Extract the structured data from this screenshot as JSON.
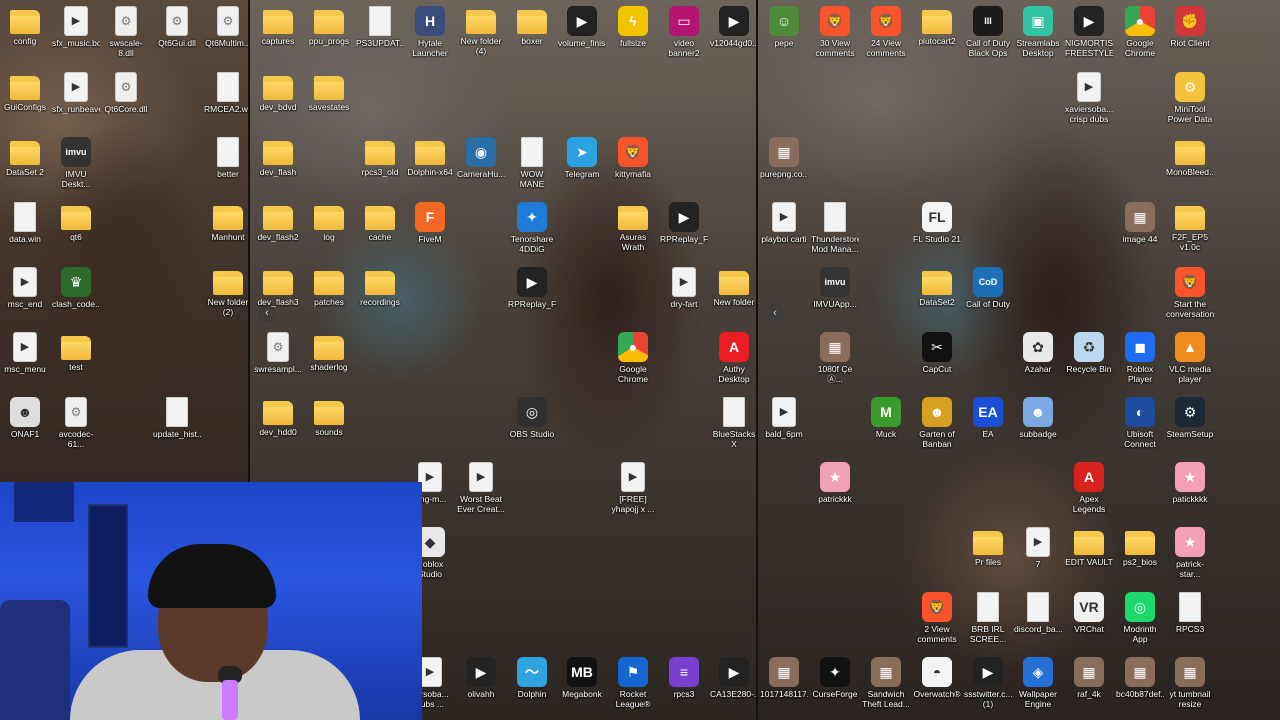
{
  "colors": {
    "folder": "#f0b93a",
    "brave": "#fb542b",
    "chrome": "#4285f4",
    "steam": "#1b2838",
    "roblox": "#1e6cf0",
    "webcam_bg": "#2a55e0"
  },
  "pane1": {
    "icons": [
      {
        "label": "config",
        "type": "folder"
      },
      {
        "label": "sfx_music.box",
        "type": "video"
      },
      {
        "label": "swscale-8.dll",
        "type": "gear"
      },
      {
        "label": "Qt6Gui.dll",
        "type": "gear"
      },
      {
        "label": "Qt6Multim...",
        "type": "gear"
      },
      {
        "label": "GuiConfigs",
        "type": "folder"
      },
      {
        "label": "sfx_runbeaver",
        "type": "video"
      },
      {
        "label": "Qt6Core.dll",
        "type": "gear"
      },
      {
        "label": "RMCEA2.w...",
        "type": "file"
      },
      {
        "label": "DataSet 2",
        "type": "folder"
      },
      {
        "label": "IMVU Deskt...",
        "type": "app",
        "icon": "imvu-icon"
      },
      {
        "label": "better",
        "type": "file"
      },
      {
        "label": "data.win",
        "type": "file"
      },
      {
        "label": "qt6",
        "type": "folder"
      },
      {
        "label": "Manhunt",
        "type": "folder"
      },
      {
        "label": "msc_end",
        "type": "video"
      },
      {
        "label": "clash_code...",
        "type": "app",
        "icon": "clash-icon"
      },
      {
        "label": "New folder (2)",
        "type": "folder"
      },
      {
        "label": "msc_menu",
        "type": "video"
      },
      {
        "label": "test",
        "type": "folder"
      },
      {
        "label": "ONAF1",
        "type": "app",
        "icon": "onaf-icon"
      },
      {
        "label": "avcodec-61...",
        "type": "gear"
      },
      {
        "label": "update_hist...",
        "type": "file"
      }
    ]
  },
  "pane2": {
    "icons": [
      {
        "label": "captures",
        "type": "folder"
      },
      {
        "label": "ppu_progs",
        "type": "folder"
      },
      {
        "label": "PS3UPDAT...",
        "type": "file"
      },
      {
        "label": "Hytale Launcher",
        "type": "app",
        "icon": "hytale-icon"
      },
      {
        "label": "New folder (4)",
        "type": "folder"
      },
      {
        "label": "boxer",
        "type": "folder"
      },
      {
        "label": "volume_finished",
        "type": "app",
        "icon": "video-thumb-icon"
      },
      {
        "label": "fullsize",
        "type": "app",
        "icon": "pikachu-icon"
      },
      {
        "label": "video banner2",
        "type": "app",
        "icon": "banner-icon"
      },
      {
        "label": "v12044gd0...",
        "type": "app",
        "icon": "video-thumb-icon"
      },
      {
        "label": "dev_bdvd",
        "type": "folder"
      },
      {
        "label": "savestates",
        "type": "folder"
      },
      {
        "label": "dev_flash",
        "type": "folder"
      },
      {
        "label": "rpcs3_old",
        "type": "folder"
      },
      {
        "label": "Dolphin-x64",
        "type": "folder"
      },
      {
        "label": "CameraHu...",
        "type": "app",
        "icon": "camera-icon"
      },
      {
        "label": "WOW MANE",
        "type": "file"
      },
      {
        "label": "Telegram",
        "type": "app",
        "icon": "telegram-icon"
      },
      {
        "label": "kittymafia",
        "type": "app",
        "icon": "brave-icon"
      },
      {
        "label": "dev_flash2",
        "type": "folder"
      },
      {
        "label": "log",
        "type": "folder"
      },
      {
        "label": "cache",
        "type": "folder"
      },
      {
        "label": "FiveM",
        "type": "app",
        "icon": "fivem-icon"
      },
      {
        "label": "Tenorshare 4DDiG",
        "type": "app",
        "icon": "tenorshare-icon"
      },
      {
        "label": "Asuras Wrath (USA) (En,Ja...",
        "type": "folder"
      },
      {
        "label": "RPReplay_F...",
        "type": "app",
        "icon": "video-thumb-icon"
      },
      {
        "label": "dev_flash3",
        "type": "folder"
      },
      {
        "label": "patches",
        "type": "folder"
      },
      {
        "label": "recordings",
        "type": "folder"
      },
      {
        "label": "RPReplay_F...",
        "type": "app",
        "icon": "video-thumb-icon"
      },
      {
        "label": "dry-fart",
        "type": "video"
      },
      {
        "label": "New folder",
        "type": "folder"
      },
      {
        "label": "swresampl...",
        "type": "gear"
      },
      {
        "label": "shaderlog",
        "type": "folder"
      },
      {
        "label": "Google Chrome",
        "type": "app",
        "icon": "chrome-icon"
      },
      {
        "label": "Authy Desktop",
        "type": "app",
        "icon": "authy-icon"
      },
      {
        "label": "dev_hdd0",
        "type": "folder"
      },
      {
        "label": "sounds",
        "type": "folder"
      },
      {
        "label": "OBS Studio",
        "type": "app",
        "icon": "obs-icon"
      },
      {
        "label": "BlueStacks X",
        "type": "file"
      },
      {
        "label": "king-m...",
        "type": "video"
      },
      {
        "label": "Worst Beat Ever Creat...",
        "type": "video"
      },
      {
        "label": "[FREE] yhapojj x ...",
        "type": "video"
      },
      {
        "label": "Roblox Studio",
        "type": "app",
        "icon": "roblox-studio-icon"
      },
      {
        "label": "versoba... dubs ...",
        "type": "video"
      },
      {
        "label": "olivahh",
        "type": "app",
        "icon": "video-thumb-icon"
      },
      {
        "label": "Dolphin",
        "type": "app",
        "icon": "dolphin-icon"
      },
      {
        "label": "Megabonk",
        "type": "app",
        "icon": "megabonk-icon"
      },
      {
        "label": "Rocket League®",
        "type": "app",
        "icon": "rocket-league-icon"
      },
      {
        "label": "rpcs3",
        "type": "app",
        "icon": "rpcs3-icon"
      },
      {
        "label": "CA13E280-...",
        "type": "app",
        "icon": "video-thumb-icon"
      }
    ]
  },
  "pane3": {
    "icons": [
      {
        "label": "pepe",
        "type": "app",
        "icon": "pepe-icon"
      },
      {
        "label": "30 View comments",
        "type": "app",
        "icon": "brave-icon"
      },
      {
        "label": "24 View comments",
        "type": "app",
        "icon": "brave-icon"
      },
      {
        "label": "plutocart2",
        "type": "folder"
      },
      {
        "label": "Call of Duty Black Ops III",
        "type": "app",
        "icon": "cod-icon"
      },
      {
        "label": "Streamlabs Desktop",
        "type": "app",
        "icon": "streamlabs-icon"
      },
      {
        "label": "NIGMORTIS FREESTYLE...",
        "type": "app",
        "icon": "video-thumb-icon"
      },
      {
        "label": "Google Chrome",
        "type": "app",
        "icon": "chrome-icon"
      },
      {
        "label": "Riot Client",
        "type": "app",
        "icon": "riot-icon"
      },
      {
        "label": "xaviersoba... crisp dubs ...",
        "type": "video"
      },
      {
        "label": "MiniTool Power Data ...",
        "type": "app",
        "icon": "minitool-icon"
      },
      {
        "label": "purepng.co...",
        "type": "app",
        "icon": "image-icon"
      },
      {
        "label": "MonoBleed...",
        "type": "folder"
      },
      {
        "label": "playboi carti",
        "type": "video"
      },
      {
        "label": "Thunderstore Mod Mana...",
        "type": "file"
      },
      {
        "label": "FL Studio 21",
        "type": "app",
        "icon": "fl-studio-icon"
      },
      {
        "label": "image 44",
        "type": "app",
        "icon": "image-icon"
      },
      {
        "label": "F2F_EP5 v1.0c",
        "type": "folder"
      },
      {
        "label": "IMVUApp...",
        "type": "app",
        "icon": "imvu-icon"
      },
      {
        "label": "DataSet2",
        "type": "folder"
      },
      {
        "label": "Call of Duty",
        "type": "app",
        "icon": "cod2-icon"
      },
      {
        "label": "Start the conversation",
        "type": "app",
        "icon": "brave-icon"
      },
      {
        "label": "1080f Çe Ⓐ... Facebook P...",
        "type": "app",
        "icon": "image-icon"
      },
      {
        "label": "CapCut",
        "type": "app",
        "icon": "capcut-icon"
      },
      {
        "label": "Azahar",
        "type": "app",
        "icon": "azahar-icon"
      },
      {
        "label": "Recycle Bin",
        "type": "app",
        "icon": "recycle-bin-icon"
      },
      {
        "label": "Roblox Player",
        "type": "app",
        "icon": "roblox-icon"
      },
      {
        "label": "VLC media player",
        "type": "app",
        "icon": "vlc-icon"
      },
      {
        "label": "bald_6pm",
        "type": "video"
      },
      {
        "label": "Muck",
        "type": "app",
        "icon": "muck-icon"
      },
      {
        "label": "Garten of Banban",
        "type": "app",
        "icon": "banban-icon"
      },
      {
        "label": "EA",
        "type": "app",
        "icon": "ea-icon"
      },
      {
        "label": "subbadge",
        "type": "app",
        "icon": "subbadge-icon"
      },
      {
        "label": "Ubisoft Connect",
        "type": "app",
        "icon": "ubisoft-icon"
      },
      {
        "label": "SteamSetup",
        "type": "app",
        "icon": "steam-icon"
      },
      {
        "label": "patrickkk",
        "type": "app",
        "icon": "patrick-icon"
      },
      {
        "label": "Apex Legends",
        "type": "app",
        "icon": "apex-icon"
      },
      {
        "label": "patickkkk",
        "type": "app",
        "icon": "patrick-icon"
      },
      {
        "label": "Pr files",
        "type": "folder"
      },
      {
        "label": "7",
        "type": "video"
      },
      {
        "label": "EDIT VAULT",
        "type": "folder"
      },
      {
        "label": "ps2_bios",
        "type": "folder"
      },
      {
        "label": "patrick-star...",
        "type": "app",
        "icon": "patrick-icon"
      },
      {
        "label": "2 View comments",
        "type": "app",
        "icon": "brave-icon"
      },
      {
        "label": "BRB IRL SCREE...",
        "type": "file"
      },
      {
        "label": "discord_ba...",
        "type": "file"
      },
      {
        "label": "VRChat",
        "type": "app",
        "icon": "vrchat-icon"
      },
      {
        "label": "Modrinth App",
        "type": "app",
        "icon": "modrinth-icon"
      },
      {
        "label": "RPCS3",
        "type": "file"
      },
      {
        "label": "1017148117...",
        "type": "app",
        "icon": "image-icon"
      },
      {
        "label": "CurseForge",
        "type": "app",
        "icon": "curseforge-icon"
      },
      {
        "label": "Sandwich Theft Lead...",
        "type": "app",
        "icon": "image-icon"
      },
      {
        "label": "Overwatch®",
        "type": "app",
        "icon": "overwatch-icon"
      },
      {
        "label": "ssstwitter.c... (1)",
        "type": "app",
        "icon": "video-thumb-icon"
      },
      {
        "label": "Wallpaper Engine",
        "type": "app",
        "icon": "wallpaper-engine-icon"
      },
      {
        "label": "raf_4k",
        "type": "app",
        "icon": "image-icon"
      },
      {
        "label": "bc40b87def...",
        "type": "app",
        "icon": "image-icon"
      },
      {
        "label": "yt tumbnail resize",
        "type": "app",
        "icon": "image-icon"
      }
    ]
  }
}
